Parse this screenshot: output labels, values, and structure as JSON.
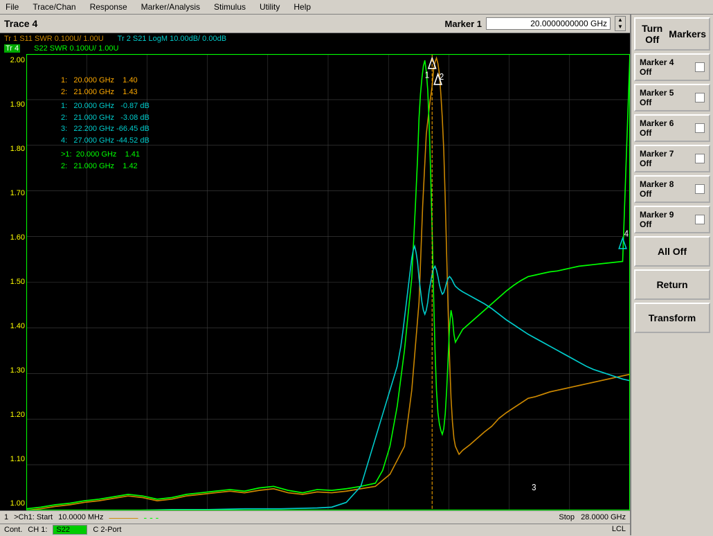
{
  "menubar": {
    "items": [
      "File",
      "Trace/Chan",
      "Response",
      "Marker/Analysis",
      "Stimulus",
      "Utility",
      "Help"
    ]
  },
  "chart": {
    "title": "Trace 4",
    "marker_label": "Marker 1",
    "marker_value": "20.0000000000 GHz"
  },
  "traces": {
    "tr1": "Tr 1  S11 SWR 0.100U/  1.00U",
    "tr2": "Tr 2  S21 LogM 10.00dB/  0.00dB",
    "tr4_label": "Tr 4",
    "tr4_rest": " S22 SWR 0.100U/  1.00U"
  },
  "y_axis": {
    "labels": [
      "2.00",
      "1.90",
      "1.80",
      "1.70",
      "1.60",
      "1.50",
      "1.40",
      "1.30",
      "1.20",
      "1.10",
      "1.00"
    ]
  },
  "marker_data": [
    {
      "trace": "1:",
      "freq": "20.000 GHz",
      "value": "1.40",
      "color": "yellow"
    },
    {
      "trace": "2:",
      "freq": "21.000 GHz",
      "value": "1.43",
      "color": "yellow"
    },
    {
      "trace": "1:",
      "freq": "20.000 GHz",
      "value": "-0.87 dB",
      "color": "cyan"
    },
    {
      "trace": "2:",
      "freq": "21.000 GHz",
      "value": "-3.08 dB",
      "color": "cyan"
    },
    {
      "trace": "3:",
      "freq": "22.200 GHz",
      "value": "-66.45 dB",
      "color": "cyan"
    },
    {
      "trace": "4:",
      "freq": "27.000 GHz",
      "value": "-44.52 dB",
      "color": "cyan"
    },
    {
      "trace": ">1:",
      "freq": "20.000 GHz",
      "value": "1.41",
      "color": "green"
    },
    {
      "trace": "2:",
      "freq": "21.000 GHz",
      "value": "1.42",
      "color": "green"
    }
  ],
  "status_bottom": {
    "channel_num": "1",
    "ch1_label": ">Ch1: Start",
    "start_freq": "10.0000 MHz",
    "stop_label": "Stop",
    "stop_freq": "28.0000 GHz"
  },
  "footer": {
    "cont": "Cont.",
    "ch_label": "CH 1:",
    "s22": "S22",
    "port": "C  2-Port",
    "lcl": "LCL"
  },
  "sidebar": {
    "btn1_line1": "Turn Off",
    "btn1_line2": "Markers",
    "btn2_line1": "Marker 4",
    "btn2_line2": "Off",
    "btn3_line1": "Marker 5",
    "btn3_line2": "Off",
    "btn4_line1": "Marker 6",
    "btn4_line2": "Off",
    "btn5_line1": "Marker 7",
    "btn5_line2": "Off",
    "btn6_line1": "Marker 8",
    "btn6_line2": "Off",
    "btn7_line1": "Marker 9",
    "btn7_line2": "Off",
    "btn8": "All Off",
    "btn9": "Return",
    "btn10": "Transform"
  }
}
